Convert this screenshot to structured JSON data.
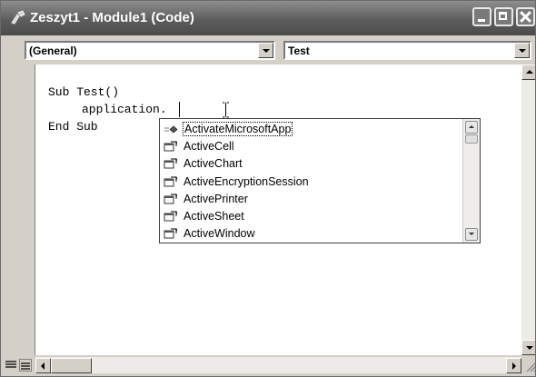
{
  "window": {
    "title": "Zeszyt1 - Module1 (Code)"
  },
  "combos": {
    "object": {
      "value": "(General)"
    },
    "procedure": {
      "value": "Test"
    }
  },
  "code": {
    "lines": [
      "Sub Test()",
      "application.",
      "End Sub"
    ]
  },
  "autocomplete": {
    "items": [
      {
        "label": "ActivateMicrosoftApp",
        "icon": "method-icon",
        "selected": true
      },
      {
        "label": "ActiveCell",
        "icon": "property-icon",
        "selected": false
      },
      {
        "label": "ActiveChart",
        "icon": "property-icon",
        "selected": false
      },
      {
        "label": "ActiveEncryptionSession",
        "icon": "property-icon",
        "selected": false
      },
      {
        "label": "ActivePrinter",
        "icon": "property-icon",
        "selected": false
      },
      {
        "label": "ActiveSheet",
        "icon": "property-icon",
        "selected": false
      },
      {
        "label": "ActiveWindow",
        "icon": "property-icon",
        "selected": false
      }
    ]
  },
  "colors": {
    "titlebar": "#5d5d5d",
    "background": "#d4d0c8",
    "editor": "#ffffff"
  }
}
